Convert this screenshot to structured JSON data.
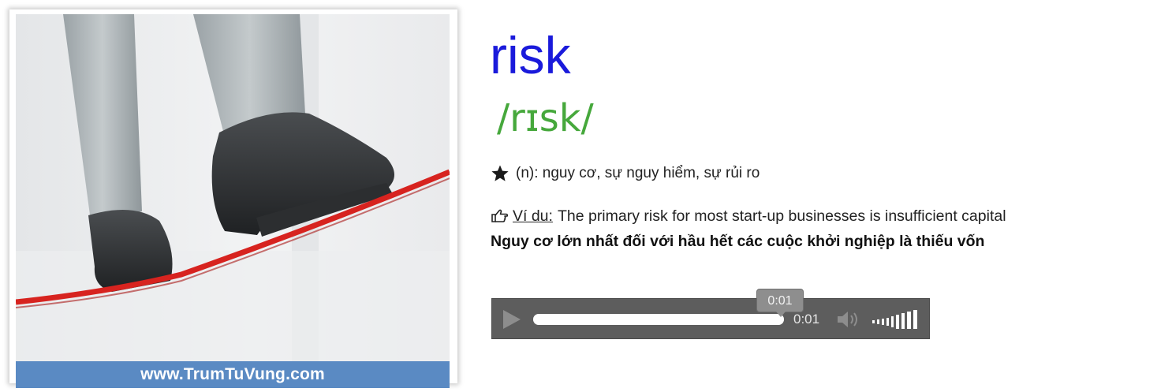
{
  "card": {
    "site_url": "www.TrumTuVung.com"
  },
  "word": {
    "headword": "risk",
    "ipa": "/rɪsk/",
    "meaning": "(n): nguy cơ, sự nguy hiểm, sự rủi ro",
    "example_label": "Ví du:",
    "example_text": "The primary risk for most start-up businesses is insufficient capital",
    "translation": "Nguy cơ lớn nhất đối với hầu hết các cuộc khởi nghiệp là thiếu vốn"
  },
  "player": {
    "tooltip_time": "0:01",
    "elapsed_time": "0:01",
    "progress": 1.0,
    "volume_level": 1.0
  },
  "colors": {
    "headword": "#1a1adb",
    "ipa": "#46a83c",
    "banner": "#5a8ac3",
    "rope": "#d7231f",
    "player_bg": "#5d5d5d"
  },
  "icons": {
    "meaning": "star-icon",
    "example": "pointing-hand-icon",
    "play": "play-icon",
    "volume": "volume-icon"
  }
}
